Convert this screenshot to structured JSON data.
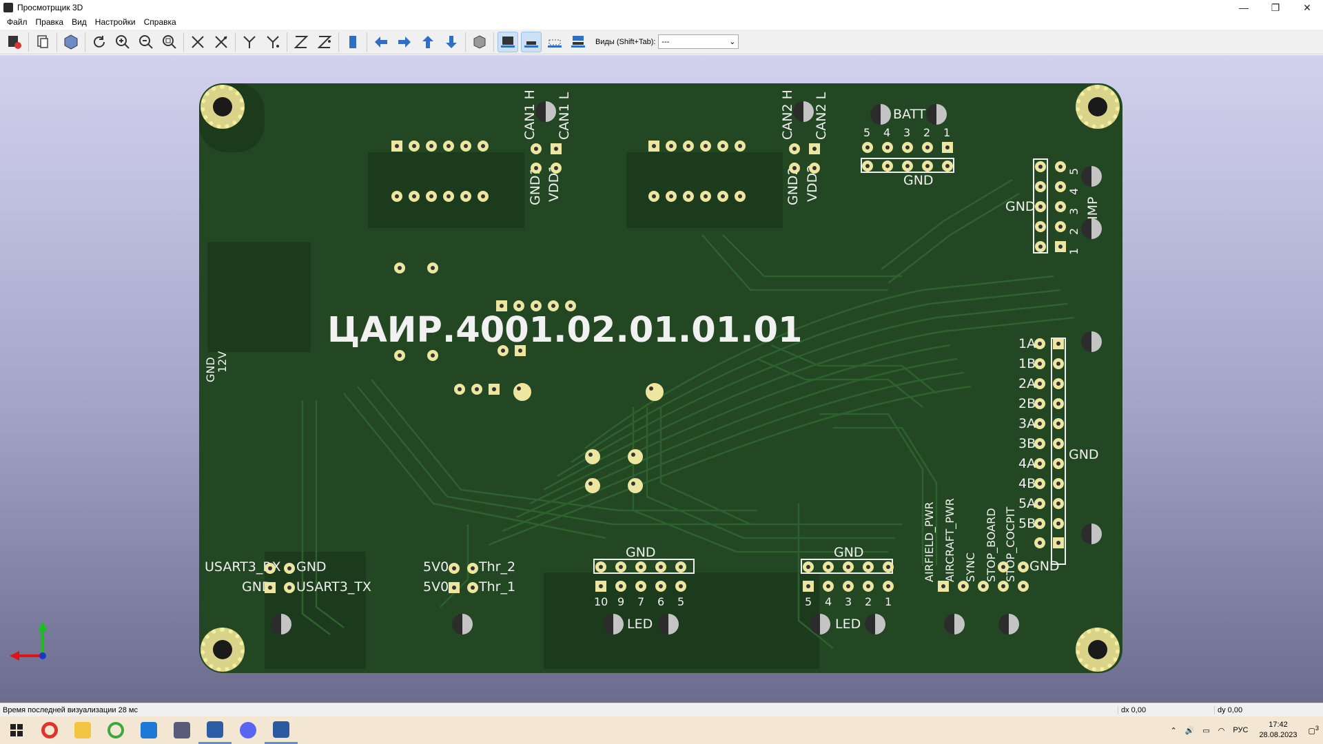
{
  "window": {
    "title": "Просмотрщик 3D",
    "controls": [
      "—",
      "❐",
      "✕"
    ]
  },
  "menu": [
    "Файл",
    "Правка",
    "Вид",
    "Настройки",
    "Справка"
  ],
  "toolbar": {
    "views_label": "Виды (Shift+Tab):",
    "views_value": "---",
    "buttons": [
      "reload-board-icon",
      "copy-icon",
      "render-icon",
      "refresh-icon",
      "zoom-in-icon",
      "zoom-out-icon",
      "zoom-fit-icon",
      "rotate-x-cw-icon",
      "rotate-x-ccw-icon",
      "rotate-y-cw-icon",
      "rotate-y-ccw-icon",
      "rotate-z-cw-icon",
      "rotate-z-ccw-icon",
      "flip-board-icon",
      "move-left-icon",
      "move-right-icon",
      "move-up-icon",
      "move-down-icon",
      "ortho-icon",
      "show-tht-icon",
      "show-smd-icon",
      "show-virtual-icon",
      "show-pos-icon"
    ]
  },
  "board": {
    "title_text": "ЦАИР.4001.02.01.01.01",
    "labels": {
      "can1h": "CAN1 H",
      "can1l": "CAN1 L",
      "can2h": "CAN2 H",
      "can2l": "CAN2 L",
      "gnd1": "GND1",
      "vdd1": "VDD1",
      "gnd2": "GND2",
      "vdd2": "VDD2",
      "batt": "BATT",
      "batt_nums": [
        "5",
        "4",
        "3",
        "2",
        "1"
      ],
      "gnd": "GND",
      "imp": "IMP",
      "imp_nums": [
        "5",
        "4",
        "3",
        "2",
        "1"
      ],
      "gnd_12v": [
        "GND",
        "12V"
      ],
      "motor": [
        "1A",
        "1B",
        "2A",
        "2B",
        "3A",
        "3B",
        "4A",
        "4B",
        "5A",
        "5B"
      ],
      "usart": {
        "rx": "USART3_RX",
        "gnd": "GND",
        "tx": "USART3_TX"
      },
      "thr": {
        "v5": "5V0",
        "thr2": "Thr_2",
        "thr1": "Thr_1"
      },
      "led": "LED",
      "led_left_nums": [
        "10",
        "9",
        "7",
        "6",
        "5"
      ],
      "led_right_nums": [
        "5",
        "4",
        "3",
        "2",
        "1"
      ],
      "bottom_right": [
        "AIRFIELD_PWR",
        "AIRCRAFT_PWR",
        "SYNC",
        "STOP_BOARD",
        "STOP_COCPIT"
      ]
    }
  },
  "status": {
    "message": "Время последней визуализации 28 мс",
    "dx": "dx 0,00",
    "dy": "dy 0,00"
  },
  "taskbar": {
    "apps": [
      "windows-start-icon",
      "opera-icon",
      "file-explorer-icon",
      "green-circle-app-icon",
      "l-app-icon",
      "tools-app-icon",
      "kicad-icon",
      "discord-icon",
      "image-viewer-icon"
    ],
    "tray": {
      "lang": "РУС",
      "time": "17:42",
      "date": "28.08.2023",
      "notifications": "3"
    }
  },
  "colors": {
    "board": "#224722",
    "trace": "#2e5f2e",
    "pad": "#ece6a0",
    "silk": "#f1f1f1"
  }
}
